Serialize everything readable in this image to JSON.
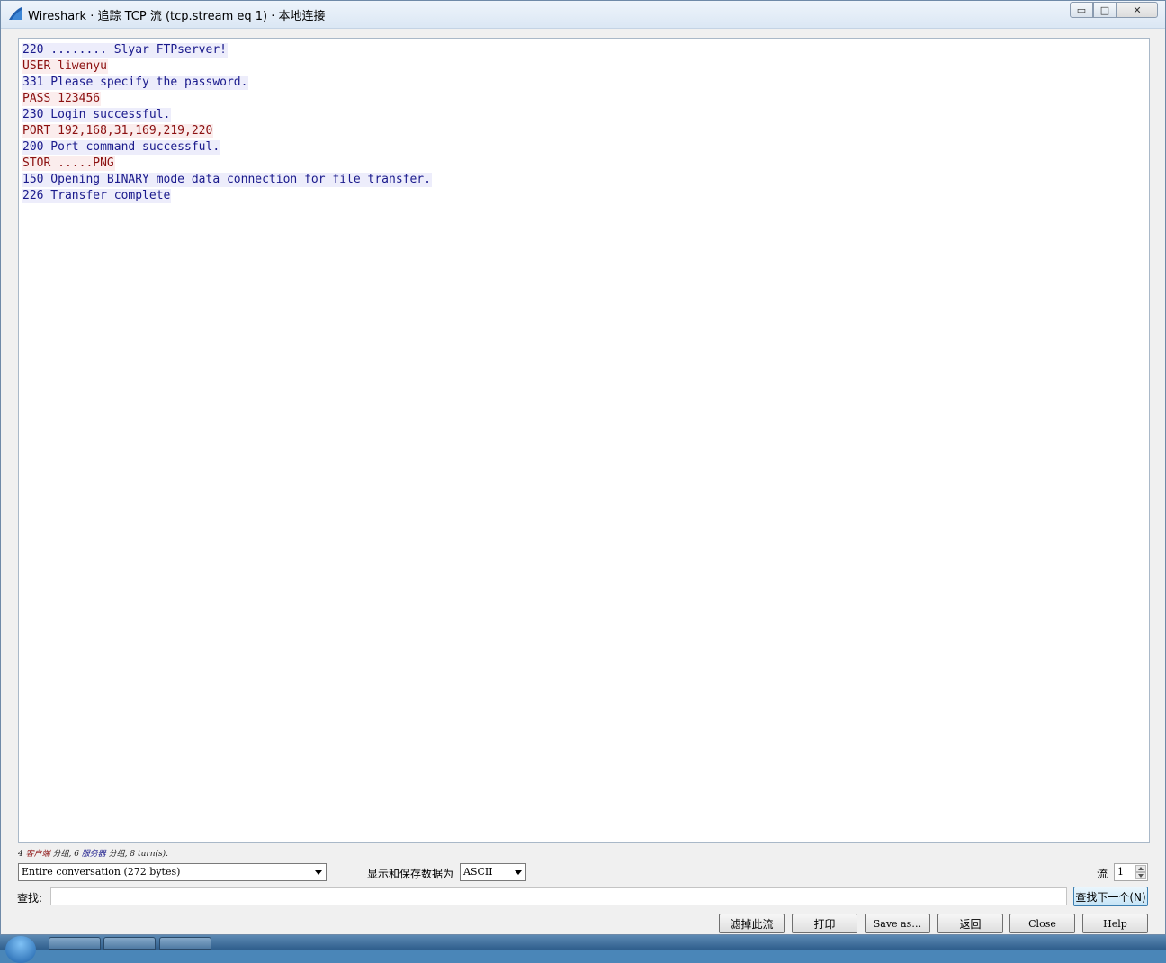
{
  "window": {
    "title": "Wireshark · 追踪 TCP 流 (tcp.stream eq 1) · 本地连接",
    "min_glyph": "▭",
    "max_glyph": "□",
    "close_glyph": "✕"
  },
  "stream_lines": [
    {
      "side": "server",
      "text": "220 ........ Slyar FTPserver!"
    },
    {
      "side": "client",
      "text": "USER liwenyu"
    },
    {
      "side": "server",
      "text": "331 Please specify the password."
    },
    {
      "side": "client",
      "text": "PASS 123456"
    },
    {
      "side": "server",
      "text": "230 Login successful."
    },
    {
      "side": "client",
      "text": "PORT 192,168,31,169,219,220"
    },
    {
      "side": "server",
      "text": "200 Port command successful."
    },
    {
      "side": "client",
      "text": "STOR .....PNG"
    },
    {
      "side": "server",
      "text": "150 Opening BINARY mode data connection for file transfer."
    },
    {
      "side": "server",
      "text": "226 Transfer complete"
    }
  ],
  "colors": {
    "client_text": "#8b1010",
    "client_bg": "#fbeded",
    "server_text": "#1a1a8c",
    "server_bg": "#ededfb"
  },
  "stats": {
    "client_count": "4 ",
    "client_label": "客户端",
    "client_suffix": " 分组, ",
    "server_count": "6 ",
    "server_label": "服务器",
    "server_suffix": " 分组, 8 turn(s)."
  },
  "controls": {
    "conversation_select": "Entire conversation (272 bytes)",
    "format_label": "显示和保存数据为",
    "format_select": "ASCII",
    "stream_label": "流",
    "stream_value": "1",
    "find_label": "查找:",
    "find_value": "",
    "find_next_button": "查找下一个(N)"
  },
  "buttons": {
    "filter_out": "滤掉此流",
    "print": "打印",
    "save_as": "Save as…",
    "back": "返回",
    "close": "Close",
    "help": "Help"
  },
  "icons": {
    "app": "wireshark-fin-icon",
    "dropdown": "chevron-down-icon"
  }
}
